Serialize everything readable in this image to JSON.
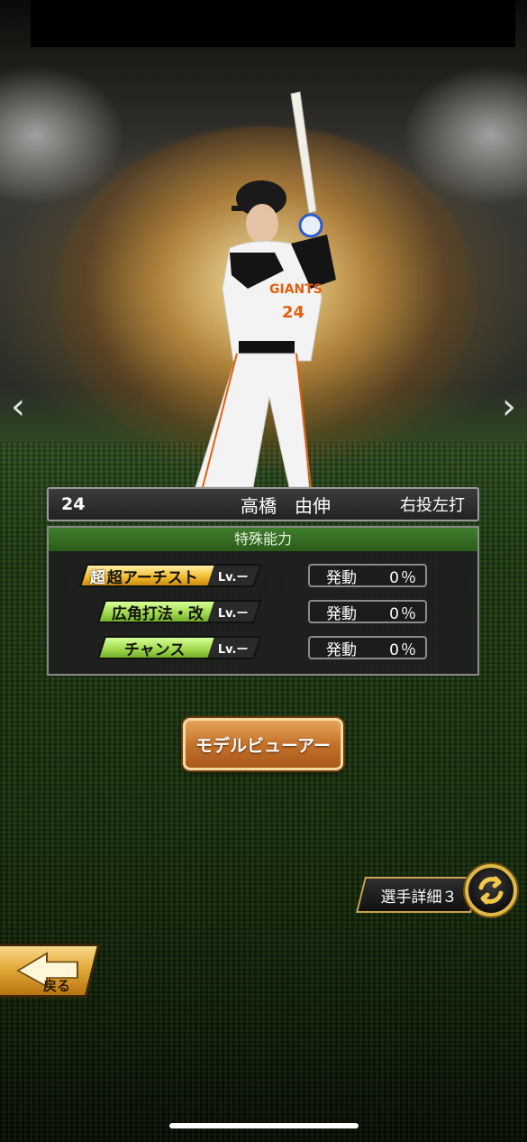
{
  "player": {
    "number": "24",
    "name": "高橋　由伸",
    "throw_bat": "右投左打"
  },
  "abilities_panel": {
    "title": "特殊能力",
    "abilities": [
      {
        "name": "超アーチスト",
        "prefix": "超",
        "level": "Lv.ー",
        "activation_label": "発動",
        "activation_value": "0％",
        "tier": "gold"
      },
      {
        "name": "広角打法・改",
        "prefix": "",
        "level": "Lv.ー",
        "activation_label": "発動",
        "activation_value": "0％",
        "tier": "green"
      },
      {
        "name": "チャンス",
        "prefix": "",
        "level": "Lv.ー",
        "activation_label": "発動",
        "activation_value": "0％",
        "tier": "green"
      }
    ]
  },
  "buttons": {
    "model_viewer": "モデルビューアー",
    "player_detail": "選手詳細３",
    "back": "戻る"
  },
  "nav": {
    "prev": "‹",
    "next": "›"
  },
  "uniform": {
    "jersey_number": "24",
    "chest_text": "GIANTS"
  },
  "colors": {
    "panel_header": "#3f7d2c",
    "gold_badge": "#f0b82a",
    "green_badge": "#9fd74a",
    "button_orange": "#c4732c",
    "detail_border": "#c8a24a"
  }
}
